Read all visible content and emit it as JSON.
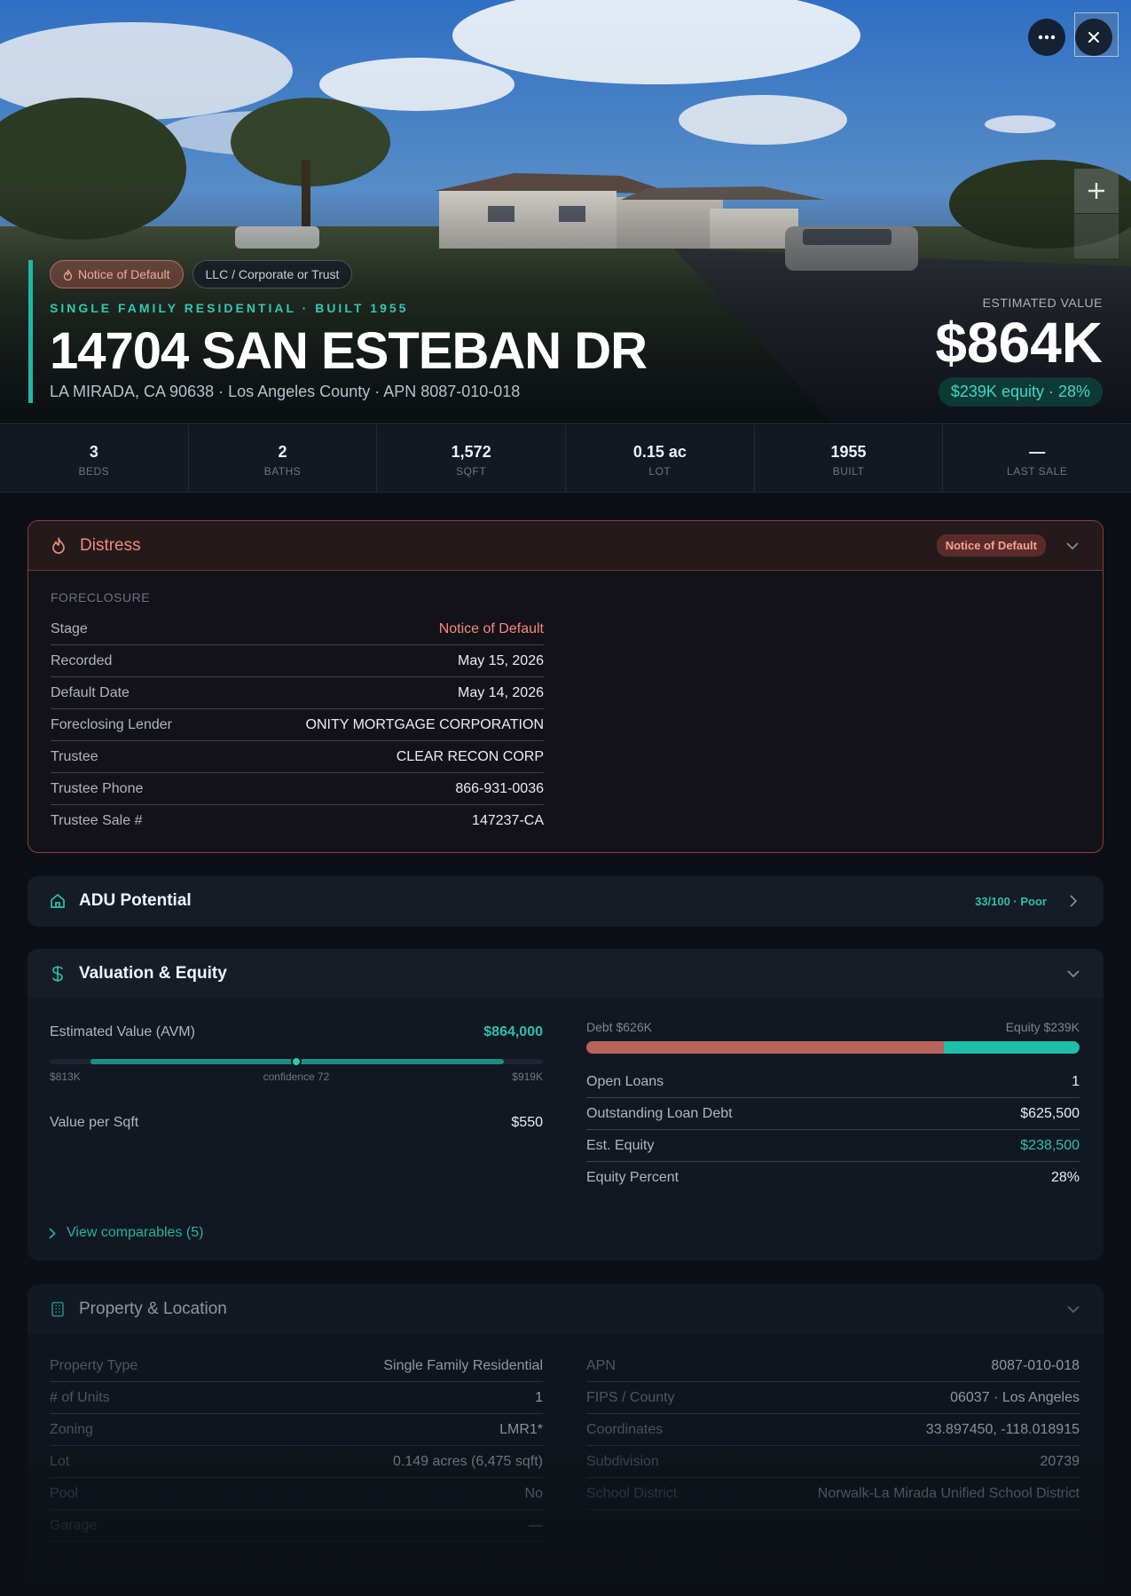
{
  "hero": {
    "tags": [
      "Notice of Default",
      "LLC / Corporate or Trust"
    ],
    "subtitle": "SINGLE FAMILY RESIDENTIAL · BUILT 1955",
    "address": "14704 SAN ESTEBAN DR",
    "address_meta": "LA MIRADA, CA 90638 · Los Angeles County · APN 8087-010-018",
    "estimated_label": "ESTIMATED VALUE",
    "estimated_value": "$864K",
    "equity_pill": "$239K equity · 28%"
  },
  "stats": [
    {
      "value": "3",
      "label": "BEDS"
    },
    {
      "value": "2",
      "label": "BATHS"
    },
    {
      "value": "1,572",
      "label": "SQFT"
    },
    {
      "value": "0.15 ac",
      "label": "LOT"
    },
    {
      "value": "1955",
      "label": "BUILT"
    },
    {
      "value": "—",
      "label": "LAST SALE"
    }
  ],
  "distress": {
    "title": "Distress",
    "badge": "Notice of Default",
    "section": "FORECLOSURE",
    "rows": [
      {
        "k": "Stage",
        "v": "Notice of Default"
      },
      {
        "k": "Recorded",
        "v": "May 15, 2026"
      },
      {
        "k": "Default Date",
        "v": "May 14, 2026"
      },
      {
        "k": "Foreclosing Lender",
        "v": "ONITY MORTGAGE CORPORATION"
      },
      {
        "k": "Trustee",
        "v": "CLEAR RECON CORP"
      },
      {
        "k": "Trustee Phone",
        "v": "866-931-0036"
      },
      {
        "k": "Trustee Sale #",
        "v": "147237-CA"
      }
    ]
  },
  "adu": {
    "title": "ADU Potential",
    "badge": "33/100 · Poor"
  },
  "valuation": {
    "title": "Valuation & Equity",
    "avm_label": "Estimated Value (AVM)",
    "avm_value": "$864,000",
    "range_low": "$813K",
    "confidence": "confidence 72",
    "range_high": "$919K",
    "value_per_sqft_label": "Value per Sqft",
    "value_per_sqft": "$550",
    "debt_label": "Debt $626K",
    "equity_label": "Equity $239K",
    "debt_fraction": 0.724,
    "rows": [
      {
        "k": "Open Loans",
        "v": "1"
      },
      {
        "k": "Outstanding Loan Debt",
        "v": "$625,500"
      },
      {
        "k": "Est. Equity",
        "v": "$238,500"
      },
      {
        "k": "Equity Percent",
        "v": "28%"
      }
    ],
    "comparables_link": "View comparables (5)"
  },
  "property": {
    "title": "Property & Location",
    "left_rows": [
      {
        "k": "Property Type",
        "v": "Single Family Residential"
      },
      {
        "k": "# of Units",
        "v": "1"
      },
      {
        "k": "Zoning",
        "v": "LMR1*"
      },
      {
        "k": "Lot",
        "v": "0.149 acres (6,475 sqft)"
      },
      {
        "k": "Pool",
        "v": "No"
      },
      {
        "k": "Garage",
        "v": "—"
      }
    ],
    "right_rows": [
      {
        "k": "APN",
        "v": "8087-010-018"
      },
      {
        "k": "FIPS / County",
        "v": "06037 · Los Angeles"
      },
      {
        "k": "Coordinates",
        "v": "33.897450, -118.018915"
      },
      {
        "k": "Subdivision",
        "v": "20739"
      },
      {
        "k": "School District",
        "v": "Norwalk-La Mirada Unified School District"
      }
    ]
  },
  "colors": {
    "accent": "#1fb8a3",
    "distress": "#f08a7c",
    "debt": "#b9645b",
    "equity": "#1fbfa9"
  }
}
